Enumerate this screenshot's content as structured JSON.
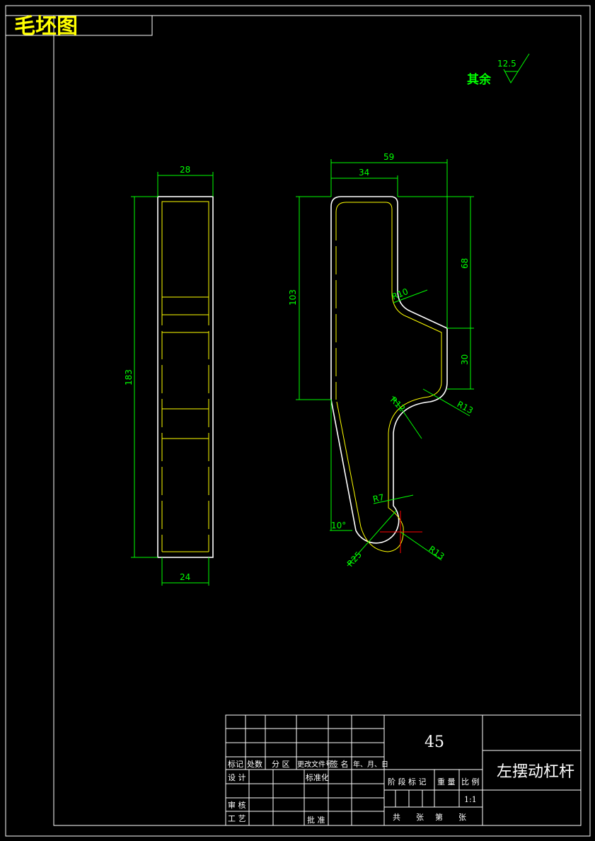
{
  "header": {
    "title": "毛坯图"
  },
  "roughness": {
    "prefix": "其余",
    "value": "12.5"
  },
  "side_view": {
    "dims": {
      "top_width": "28",
      "height": "183",
      "bottom_width": "24"
    }
  },
  "front_view": {
    "dims": {
      "overall_width": "59",
      "upper_width": "34",
      "left_height": "103",
      "right_upper": "68",
      "right_lower": "30",
      "r10": "R10",
      "r12": "R12",
      "r13_mid": "R13",
      "r7": "R7",
      "angle": "10°",
      "r25": "R25",
      "r13_bottom": "R13"
    }
  },
  "title_block": {
    "material": "45",
    "part_name": "左摆动杠杆",
    "rev_headers": [
      "标记",
      "处数",
      "分 区",
      "更改文件号",
      "签 名",
      "年、月、日"
    ],
    "left_labels": {
      "design": "设 计",
      "standardize": "标准化",
      "review": "审 核",
      "process": "工 艺",
      "approve": "批 准"
    },
    "stage_header": "阶 段 标 记",
    "weight_header": "重 量",
    "scale_header": "比 例",
    "scale_value": "1:1",
    "sheet_text": [
      "共",
      "张",
      "第",
      "张"
    ]
  },
  "colors": {
    "dimension": "#00ff00",
    "outline": "#ffffff",
    "hidden": "#ffff00",
    "center": "#ff0000",
    "title": "#ffff00"
  }
}
